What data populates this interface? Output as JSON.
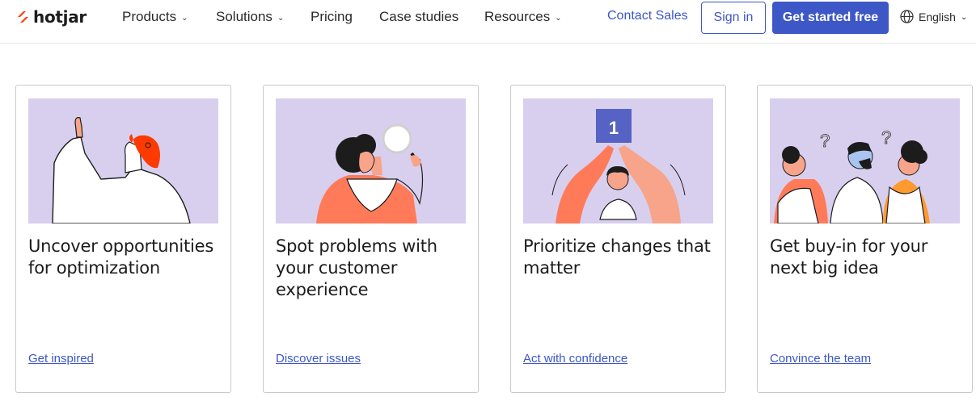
{
  "header": {
    "logo_text": "hotjar",
    "nav": [
      {
        "label": "Products",
        "has_dropdown": true
      },
      {
        "label": "Solutions",
        "has_dropdown": true
      },
      {
        "label": "Pricing",
        "has_dropdown": false
      },
      {
        "label": "Case studies",
        "has_dropdown": false
      },
      {
        "label": "Resources",
        "has_dropdown": true
      }
    ],
    "contact_sales": "Contact Sales",
    "sign_in": "Sign in",
    "get_started": "Get started free",
    "language": "English",
    "chevron": "⌄"
  },
  "colors": {
    "accent": "#3e57c7",
    "brand_orange": "#fd3a00",
    "illustration_bg": "#d8cfee"
  },
  "cards": [
    {
      "title": "Uncover opportunities for optimization",
      "link": "Get inspired",
      "illustration": "pointing-person"
    },
    {
      "title": "Spot problems with your customer experience",
      "link": "Discover issues",
      "illustration": "magnifying-glass-person"
    },
    {
      "title": "Prioritize changes that matter",
      "link": "Act with confidence",
      "illustration": "high-five-number-one",
      "badge": "1"
    },
    {
      "title": "Get buy-in for your next big idea",
      "link": "Convince the team",
      "illustration": "three-people-questions",
      "question_mark": "?"
    }
  ]
}
